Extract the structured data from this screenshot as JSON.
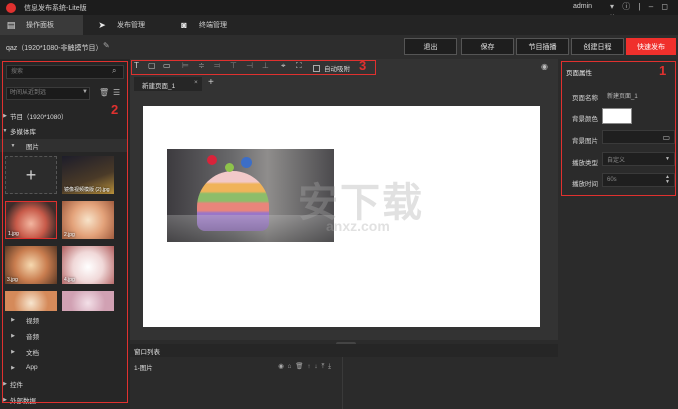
{
  "app": {
    "title": "信息发布系统-Lite版",
    "user": "admin",
    "window_controls": "▾ ⓘ | ‒ ◻ ×"
  },
  "tabs": [
    {
      "label": "操作面板",
      "icon": "panel-icon",
      "active": true
    },
    {
      "label": "发布管理",
      "icon": "send-icon",
      "active": false
    },
    {
      "label": "终端管理",
      "icon": "terminal-icon",
      "active": false
    }
  ],
  "project": {
    "name": "qaz（1920*1080-非触摸节目）"
  },
  "actions": {
    "exit": "退出",
    "save": "保存",
    "insert_program": "节目插播",
    "create_schedule": "创建日程",
    "quick_publish": "快速发布"
  },
  "left": {
    "search_placeholder": "搜索",
    "sort_label": "时间从近到远",
    "tree": {
      "program": "节目（1920*1080）",
      "media_library": "多媒体库",
      "images": "图片",
      "video": "视频",
      "audio": "音频",
      "document": "文档",
      "app": "App",
      "controls": "控件",
      "external_data": "外部数据"
    },
    "thumbs": [
      {
        "label": "镜像视频模版 (2).jpg"
      },
      {
        "label": "1.jpg"
      },
      {
        "label": "2.jpg"
      },
      {
        "label": "3.jpg"
      },
      {
        "label": "4.jpg"
      },
      {
        "label": ""
      },
      {
        "label": ""
      }
    ]
  },
  "canvas": {
    "auto_adsorb": "自动吸附",
    "page_tab": "新建页面_1",
    "page_tab_close": "×",
    "add_page": "+"
  },
  "layers": {
    "header": "窗口列表",
    "row": "1-图片",
    "row_icons": "◉ ⌂ 🗑  ↑ ↓ ⤒ ⤓"
  },
  "right": {
    "title": "页面属性",
    "fields": {
      "page_name_label": "页面名称",
      "page_name_value": "新建页面_1",
      "bg_color_label": "背景颜色",
      "bg_image_label": "背景图片",
      "play_type_label": "播放类型",
      "play_type_value": "自定义",
      "play_time_label": "播放时间",
      "play_time_value": "60s"
    }
  },
  "markers": {
    "m1": "1",
    "m2": "2",
    "m3": "3"
  },
  "watermark": {
    "main": "安下载",
    "sub": "anxz.com"
  },
  "colors": {
    "accent": "#f0302c",
    "panel": "#262626",
    "canvas_bg": "#ffffff"
  }
}
